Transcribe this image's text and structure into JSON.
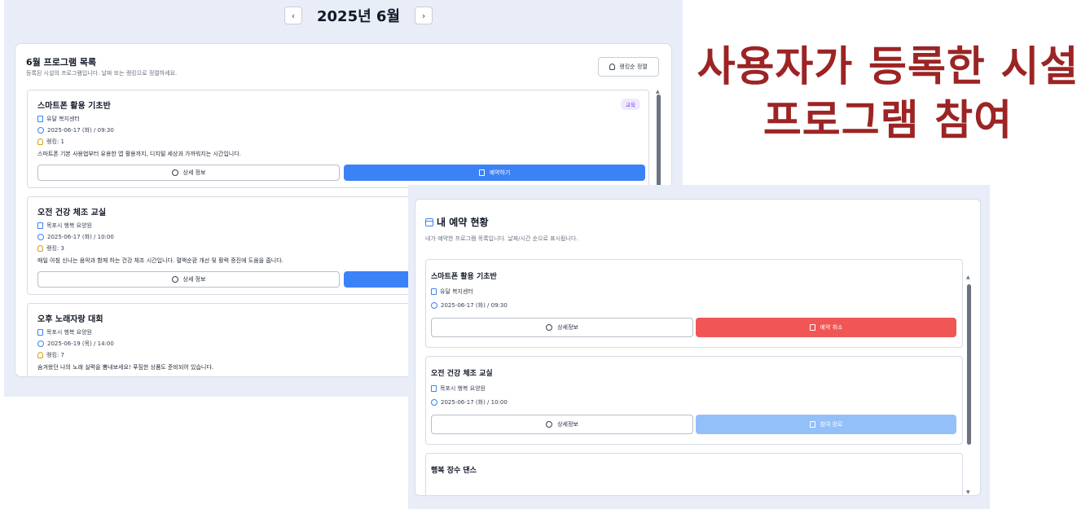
{
  "headline": {
    "line1": "사용자가 등록한 시설",
    "line2": "프로그램 참여"
  },
  "calendar_nav": {
    "prev": "‹",
    "title": "2025년 6월",
    "next": "›"
  },
  "program_list": {
    "title": "6월 프로그램 목록",
    "subtitle": "등록된 시설의 프로그램입니다. 날짜 또는 랭킹으로 정렬하세요.",
    "sort_button": "랭킹순 정렬",
    "items": [
      {
        "title": "스마트폰 활용 기초반",
        "facility": "유달 복지센터",
        "datetime": "2025-06-17 (화) / 09:30",
        "ranking": "랭킹: 1",
        "description": "스마트폰 기본 사용법부터 유용한 앱 활용까지, 디지털 세상과 가까워지는 시간입니다.",
        "tag": "교육",
        "detail_label": "상세 정보",
        "reserve_label": "예약하기"
      },
      {
        "title": "오전 건강 체조 교실",
        "facility": "목포시 행복 요양원",
        "datetime": "2025-06-17 (화) / 10:00",
        "ranking": "랭킹: 3",
        "description": "매일 아침 신나는 음악과 함께 하는 건강 체조 시간입니다. 혈액순환 개선 및 활력 증진에 도움을 줍니다.",
        "detail_label": "상세 정보"
      },
      {
        "title": "오후 노래자랑 대회",
        "facility": "목포시 행복 요양원",
        "datetime": "2025-06-19 (목) / 14:00",
        "ranking": "랭킹: 7",
        "description": "숨겨왔던 나의 노래 실력을 뽐내보세요! 푸짐한 상품도 준비되어 있습니다."
      }
    ]
  },
  "my_reservations": {
    "title": "내 예약 현황",
    "subtitle": "내가 예약한 프로그램 목록입니다. 날짜/시간 순으로 표시됩니다.",
    "items": [
      {
        "title": "스마트폰 활용 기초반",
        "facility": "유달 복지센터",
        "datetime": "2025-06-17 (화) / 09:30",
        "detail_label": "상세정보",
        "action_label": "예약 취소"
      },
      {
        "title": "오전 건강 체조 교실",
        "facility": "목포시 행복 요양원",
        "datetime": "2025-06-17 (화) / 10:00",
        "detail_label": "상세정보",
        "action_label": "참여 완료"
      },
      {
        "title": "행복 장수 댄스"
      }
    ]
  }
}
